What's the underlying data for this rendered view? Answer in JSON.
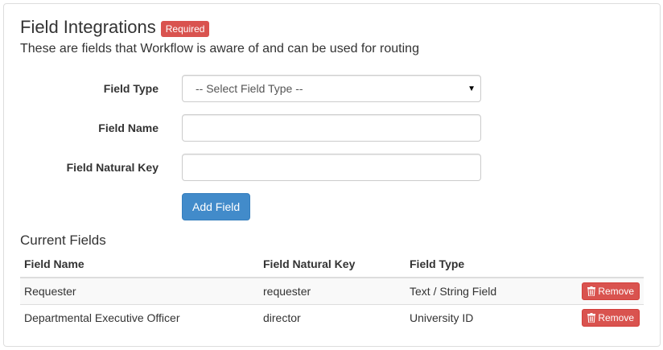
{
  "header": {
    "title": "Field Integrations",
    "required_badge": "Required",
    "subtitle": "These are fields that Workflow is aware of and can be used for routing"
  },
  "form": {
    "field_type_label": "Field Type",
    "field_type_selected": "-- Select Field Type --",
    "field_name_label": "Field Name",
    "field_name_value": "",
    "field_natural_key_label": "Field Natural Key",
    "field_natural_key_value": "",
    "add_button": "Add Field"
  },
  "current_fields": {
    "title": "Current Fields",
    "columns": [
      "Field Name",
      "Field Natural Key",
      "Field Type"
    ],
    "rows": [
      {
        "name": "Requester",
        "key": "requester",
        "type": "Text / String Field",
        "remove": "Remove"
      },
      {
        "name": "Departmental Executive Officer",
        "key": "director",
        "type": "University ID",
        "remove": "Remove"
      }
    ]
  },
  "colors": {
    "primary": "#428bca",
    "danger": "#d9534f"
  },
  "icons": {
    "remove": "trash-icon",
    "select": "caret-down-icon"
  }
}
